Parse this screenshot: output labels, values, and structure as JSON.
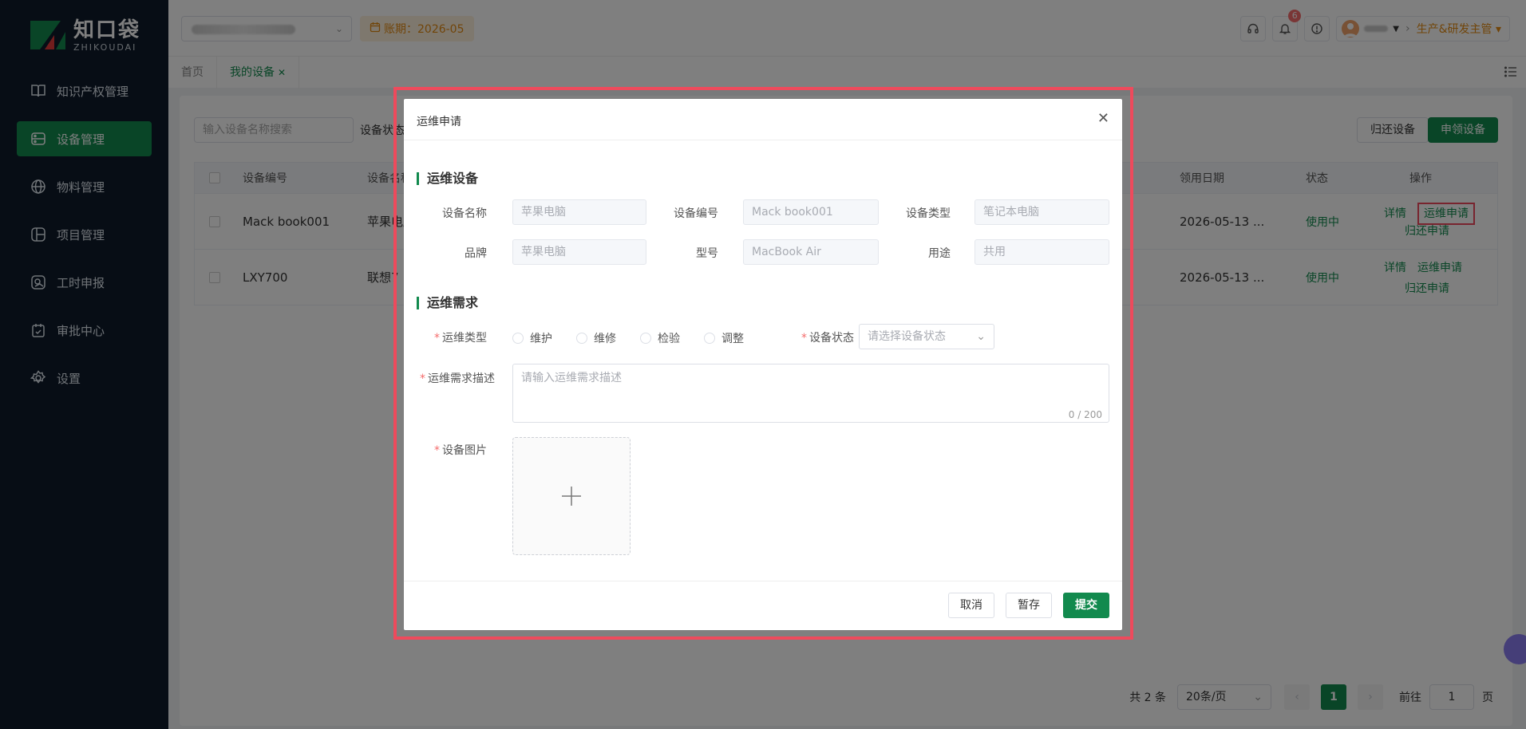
{
  "sidebar": {
    "logo_cn": "知口袋",
    "logo_en": "ZHIKOUDAI",
    "items": [
      {
        "label": "知识产权管理"
      },
      {
        "label": "设备管理"
      },
      {
        "label": "物料管理"
      },
      {
        "label": "项目管理"
      },
      {
        "label": "工时申报"
      },
      {
        "label": "审批中心"
      },
      {
        "label": "设置"
      }
    ]
  },
  "header": {
    "period": "账期：2026-05",
    "notification_count": "6",
    "role": "生产&研发主管"
  },
  "tabs": [
    {
      "label": "首页"
    },
    {
      "label": "我的设备"
    }
  ],
  "list": {
    "search_placeholder": "输入设备名称搜索",
    "status_label": "设备状态",
    "return_button": "归还设备",
    "apply_button": "申领设备",
    "columns": {
      "code": "设备编号",
      "name": "设备名称",
      "date": "领用日期",
      "status": "状态",
      "ops": "操作"
    },
    "rows": [
      {
        "code": "Mack book001",
        "name": "苹果电脑",
        "date": "2026-05-13 ...",
        "status": "使用中",
        "op_detail": "详情",
        "op_maint": "运维申请",
        "op_return": "归还申请"
      },
      {
        "code": "LXY700",
        "name": "联想7",
        "date": "2026-05-13 ...",
        "status": "使用中",
        "op_detail": "详情",
        "op_maint": "运维申请",
        "op_return": "归还申请"
      }
    ],
    "pager": {
      "total": "共 2 条",
      "page_size": "20条/页",
      "current": "1",
      "goto_label": "前往",
      "goto_value": "1",
      "page_unit": "页"
    }
  },
  "modal": {
    "title": "运维申请",
    "section_device": "运维设备",
    "fields": {
      "name_label": "设备名称",
      "name_value": "苹果电脑",
      "code_label": "设备编号",
      "code_value": "Mack book001",
      "type_label": "设备类型",
      "type_value": "笔记本电脑",
      "brand_label": "品牌",
      "brand_value": "苹果电脑",
      "model_label": "型号",
      "model_value": "MacBook Air",
      "usage_label": "用途",
      "usage_value": "共用"
    },
    "section_req": "运维需求",
    "maint_type_label": "运维类型",
    "maint_types": [
      "维护",
      "维修",
      "检验",
      "调整"
    ],
    "device_status_label": "设备状态",
    "device_status_placeholder": "请选择设备状态",
    "desc_label": "运维需求描述",
    "desc_placeholder": "请输入运维需求描述",
    "desc_counter": "0 / 200",
    "image_label": "设备图片",
    "cancel": "取消",
    "save": "暂存",
    "submit": "提交"
  },
  "colors": {
    "primary": "#128a4e",
    "sidebar_bg": "#0f1b2b",
    "highlight": "#ee4a5c",
    "period_text": "#e38a12"
  }
}
